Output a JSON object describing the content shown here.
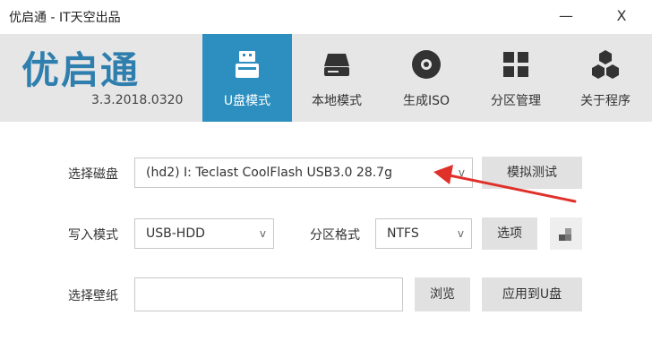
{
  "window": {
    "title": "优启通 - IT天空出品",
    "minimize": "—",
    "close": "X"
  },
  "header": {
    "logo_text": "优启通",
    "version": "3.3.2018.0320",
    "nav": [
      {
        "label": "U盘模式",
        "icon": "usb-drive-icon"
      },
      {
        "label": "本地模式",
        "icon": "hard-drive-icon"
      },
      {
        "label": "生成ISO",
        "icon": "disc-icon"
      },
      {
        "label": "分区管理",
        "icon": "partition-grid-icon"
      },
      {
        "label": "关于程序",
        "icon": "about-hexagons-icon"
      }
    ],
    "active_index": 0
  },
  "form": {
    "disk": {
      "label": "选择磁盘",
      "value": "(hd2) I: Teclast CoolFlash USB3.0 28.7g",
      "caret": "v",
      "button": "模拟测试"
    },
    "write": {
      "label": "写入模式",
      "value": "USB-HDD",
      "caret": "v"
    },
    "partition": {
      "label": "分区格式",
      "value": "NTFS",
      "caret": "v",
      "button": "选项"
    },
    "wallpaper": {
      "label": "选择壁纸",
      "value": "",
      "browse": "浏览",
      "apply": "应用到U盘"
    }
  },
  "colors": {
    "accent": "#2c8fbf",
    "logo": "#2f7fae",
    "annotation_arrow": "#e0302a"
  }
}
